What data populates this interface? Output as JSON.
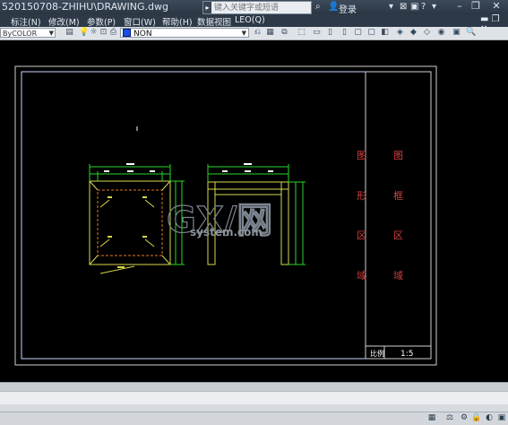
{
  "titlebar": {
    "title": "520150708-ZHIHU\\DRAWING.dwg",
    "search_placeholder": "键入关键字或短语",
    "login_label": "登录",
    "minimize": "–",
    "restore": "❐",
    "close": "✕"
  },
  "menubar": {
    "items": [
      "标注(N)",
      "修改(M)",
      "参数(P)",
      "窗口(W)",
      "帮助(H)",
      "数据视图",
      "LEO(Q)"
    ],
    "mdi_restore": "▬ ❐ ✕"
  },
  "toolbar": {
    "layer_value": "ByCOLOR",
    "linetype_value": "NON"
  },
  "drawing": {
    "title_block_left": [
      "图",
      "形",
      "区",
      "域"
    ],
    "title_block_right": [
      "图",
      "框",
      "区",
      "域"
    ],
    "scale_label": "比例",
    "scale_value": "1:5",
    "watermark_top": "GX/网",
    "watermark_bottom": "system.com"
  },
  "colors": {
    "frame": "#ffffff",
    "title_text": "#d04040",
    "geometry": "#d8d84a",
    "dimension": "#2ad62a",
    "hidden": "#e07a20"
  }
}
